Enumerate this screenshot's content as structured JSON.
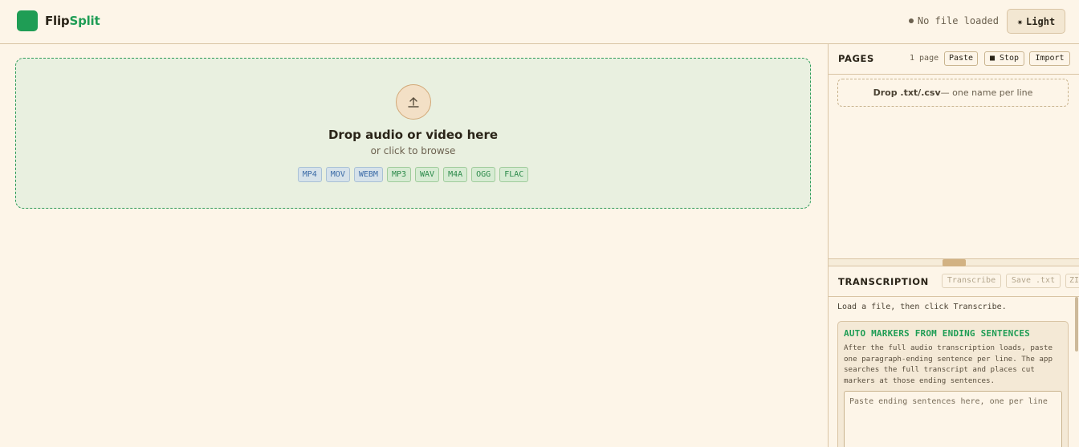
{
  "header": {
    "logo_flip": "Flip",
    "logo_split": "Split",
    "file_status": "No file loaded",
    "theme_icon": "sun-icon",
    "theme_label": "Light"
  },
  "dropzone": {
    "title": "Drop audio or video here",
    "subtitle": "or click to browse",
    "formats": [
      "MP4",
      "MOV",
      "WEBM",
      "MP3",
      "WAV",
      "M4A",
      "OGG",
      "FLAC"
    ]
  },
  "pages": {
    "title": "PAGES",
    "count": "1 page",
    "paste_label": "Paste",
    "stop_label": "■ Stop",
    "import_label": "Import",
    "drop_bold": "Drop .txt/.csv",
    "drop_rest": " — one name per line"
  },
  "transcription": {
    "title": "TRANSCRIPTION",
    "transcribe_label": "Transcribe",
    "save_label": "Save .txt",
    "zip_label": "ZIP",
    "hint": "Load a file, then click Transcribe.",
    "auto_title": "AUTO MARKERS FROM ENDING SENTENCES",
    "auto_desc": "After the full audio transcription loads, paste one paragraph-ending sentence per line. The app searches the full transcript and places cut markers at those ending sentences.",
    "auto_placeholder": "Paste ending sentences here, one per line"
  },
  "colors": {
    "accent": "#1f9d55",
    "background": "#fdf5e8",
    "dropzone_bg": "#e9f0e0"
  }
}
